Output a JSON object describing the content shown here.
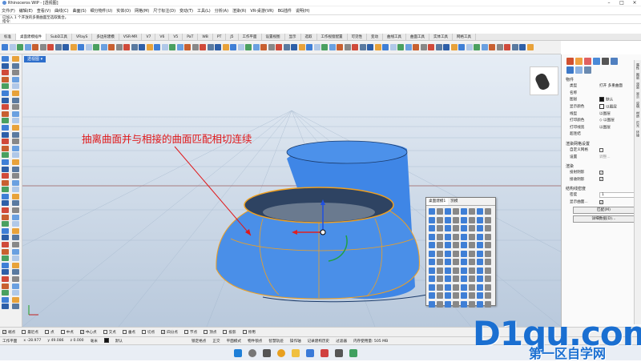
{
  "window": {
    "title": "Rhinoceros WIP - [透视图]"
  },
  "menu": [
    "文件(F)",
    "编辑(E)",
    "查看(V)",
    "曲线(C)",
    "曲面(S)",
    "细分物件(U)",
    "实体(O)",
    "网格(M)",
    "尺寸标注(D)",
    "变动(T)",
    "工具(L)",
    "分析(A)",
    "渲染(R)",
    "VR-桌游(VR)",
    "BG插件",
    "说明(H)"
  ],
  "command_history": {
    "line1": "已加入 1 个开放的多重曲面至选取集合。",
    "line2": "指令:"
  },
  "tabs": [
    "标准",
    "桌面建模插件",
    "SubD工具",
    "VRayS",
    "多边形建模",
    "VSR-MR",
    "V7",
    "V6",
    "V5",
    "PaT",
    "WB",
    "PT",
    "J5",
    "工作平面",
    "设置视图",
    "显示",
    "选取",
    "工作视窗配置",
    "可见性",
    "变动",
    "曲线工具",
    "曲面工具",
    "实体工具",
    "网格工具"
  ],
  "viewport": {
    "name": "透视图",
    "annotation": "抽离曲面并与相接的曲面匹配相切连续"
  },
  "properties": {
    "header": "物件",
    "rows": [
      {
        "k": "类型",
        "v": "打开 多重曲面"
      },
      {
        "k": "名称",
        "v": ""
      },
      {
        "k": "图层",
        "v": "默认"
      },
      {
        "k": "显示颜色",
        "v": "以图层"
      },
      {
        "k": "线型",
        "v": "以图层"
      },
      {
        "k": "打印颜色",
        "v": "以图层"
      },
      {
        "k": "打印线宽",
        "v": "以图层"
      },
      {
        "k": "超连结",
        "v": ""
      }
    ],
    "render_mesh_title": "渲染网格设置",
    "custom_mesh": "自定义网格",
    "settings_label": "设置",
    "adjust_label": "调整...",
    "render_title": "渲染",
    "cast_shadow": "投射阴影",
    "receive_shadow": "接收阴影",
    "isocurve_title": "结构线密度",
    "density_label": "密度",
    "density_value": "1",
    "show_curves": "显示曲面...",
    "btn_match": "匹配(M)",
    "btn_details": "详细数据(D)..."
  },
  "vertical_tabs": [
    "属性",
    "图层",
    "渲染",
    "显示",
    "说明",
    "材质",
    "灯光",
    "环境",
    "说明"
  ],
  "float_panel": {
    "tabs": [
      "桌面建模1",
      "凯模"
    ]
  },
  "osnap": [
    "端点",
    "最近点",
    "点",
    "中点",
    "中心点",
    "交点",
    "垂点",
    "切点",
    "四分点",
    "节点",
    "顶点",
    "投影",
    "停用"
  ],
  "status": {
    "plane": "工作平面",
    "x": "x -28.977",
    "y": "y 49.086",
    "z": "z 0.000",
    "unit": "毫米",
    "layer": "默认",
    "items": [
      "锁定格点",
      "正交",
      "平面模式",
      "物件锁点",
      "智慧轨迹",
      "操作轴",
      "记录建构历史",
      "过滤器",
      "内存使用量: 505 MB"
    ]
  },
  "watermark": {
    "main": "D1qu.com",
    "sub": "第一区自学网"
  },
  "colors": {
    "accent": "#2d6ecb",
    "annotation": "#e0181a",
    "surface": "#4a8fe8",
    "edge": "#f0a020"
  }
}
